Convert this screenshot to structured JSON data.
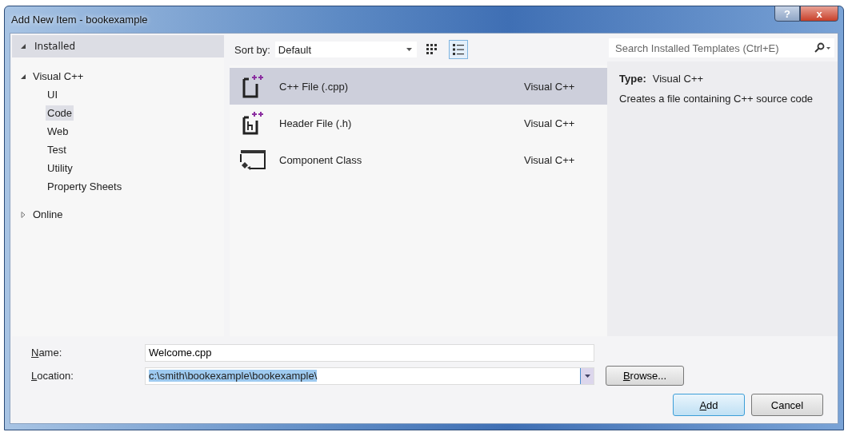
{
  "window": {
    "title": "Add New Item - bookexample"
  },
  "title_buttons": [
    {
      "kind": "help",
      "label": "?"
    },
    {
      "kind": "close",
      "label": "x"
    }
  ],
  "tree": {
    "label": "Installed",
    "expanded": true,
    "children": [
      {
        "label": "Visual C++",
        "expanded": true,
        "selected": false,
        "children": [
          {
            "label": "UI",
            "selected": false
          },
          {
            "label": "Code",
            "selected": true
          },
          {
            "label": "Web",
            "selected": false
          },
          {
            "label": "Test",
            "selected": false
          },
          {
            "label": "Utility",
            "selected": false
          },
          {
            "label": "Property Sheets",
            "selected": false
          }
        ]
      },
      {
        "label": "Online",
        "expanded": false,
        "selected": false
      }
    ]
  },
  "sort": {
    "label": "Sort by:",
    "value": "Default"
  },
  "views": [
    {
      "kind": "grid",
      "selected": false
    },
    {
      "kind": "list",
      "selected": true
    }
  ],
  "search": {
    "placeholder": "Search Installed Templates (Ctrl+E)"
  },
  "templates": [
    {
      "kind": "cpp",
      "name": "C++ File (.cpp)",
      "type": "Visual C++",
      "selected": true
    },
    {
      "kind": "header",
      "name": "Header File (.h)",
      "type": "Visual C++",
      "selected": false
    },
    {
      "kind": "component",
      "name": "Component Class",
      "type": "Visual C++",
      "selected": false
    }
  ],
  "details": {
    "type_label": "Type:",
    "type_value": "Visual C++",
    "description": "Creates a file containing C++ source code"
  },
  "name_field": {
    "label": "Name:",
    "value": "Welcome.cpp"
  },
  "location_field": {
    "label": "Location:",
    "value": "c:\\smith\\bookexample\\bookexample\\",
    "text_selected": true
  },
  "buttons": [
    {
      "kind": "browse",
      "label": "Browse...",
      "default": false
    },
    {
      "kind": "add",
      "label": "Add",
      "default": true
    },
    {
      "kind": "cancel",
      "label": "Cancel",
      "default": false
    }
  ]
}
